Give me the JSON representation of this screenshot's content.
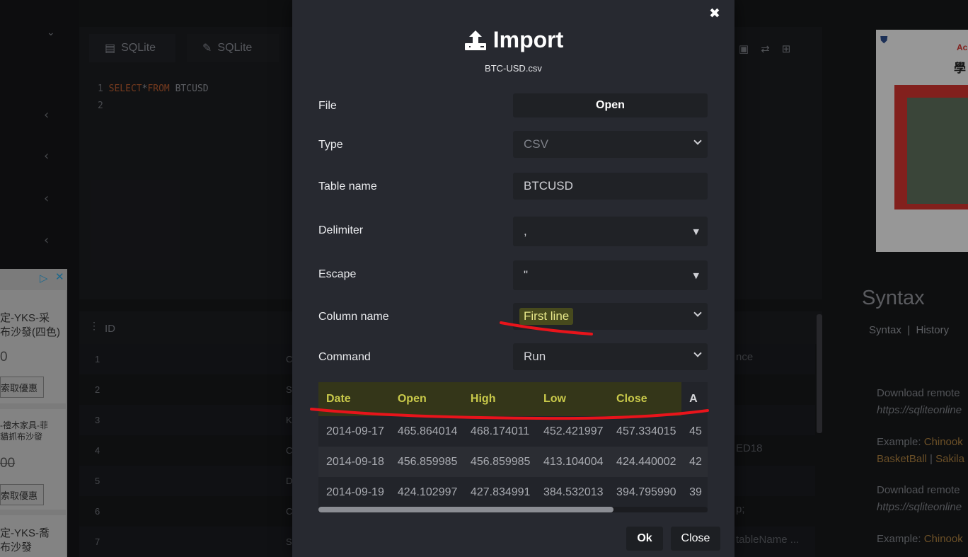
{
  "background": {
    "tabs": [
      {
        "icon": "database-icon",
        "label": "SQLite"
      },
      {
        "icon": "edit-icon",
        "label": "SQLite"
      }
    ],
    "code": {
      "line1_num": "1",
      "line1_kw1": "SELECT",
      "line1_star": "*",
      "line1_kw2": "FROM",
      "line1_table": "BTCUSD",
      "line2_num": "2"
    },
    "grid": {
      "id_header": "ID",
      "rows": [
        "1",
        "2",
        "3",
        "4",
        "5",
        "6",
        "7"
      ],
      "col2": [
        "C",
        "S",
        "K",
        "C",
        "D",
        "C",
        "S"
      ],
      "col3": [
        "nce",
        "",
        "",
        "ED18",
        "",
        "p;",
        "tableName ..."
      ]
    },
    "ads": {
      "card1_line1": "定-YKS-采",
      "card1_line2": "布沙發(四色)",
      "card1_price": "0",
      "card1_btn": "索取優惠",
      "card2_line1": "-禮木家具-菲",
      "card2_line2": "貓抓布沙發",
      "card2_price": "00",
      "card2_btn": "索取優惠",
      "card3_line1": "定-YKS-喬",
      "card3_line2": "布沙發"
    },
    "right_ad": {
      "text1": "Ac",
      "text2": "學"
    },
    "syntax": {
      "title": "Syntax",
      "link1": "Syntax",
      "sep": "|",
      "link2": "History",
      "p1": "Download remote",
      "p1_url": "https://sqliteonline",
      "p2_prefix": "Example: ",
      "p2_link1": "Chinook",
      "p2_link2": "BasketBall",
      "p2_sep": " | ",
      "p2_link3": "Sakila",
      "p3": "Download remote",
      "p3_url": "https://sqliteonline",
      "p4_prefix": "Example: ",
      "p4_link1": "Chinook"
    }
  },
  "modal": {
    "close_glyph": "✖",
    "title": "Import",
    "filename": "BTC-USD.csv",
    "fields": {
      "file_label": "File",
      "file_button": "Open",
      "type_label": "Type",
      "type_value": "CSV",
      "table_label": "Table name",
      "table_value": "BTCUSD",
      "delimiter_label": "Delimiter",
      "delimiter_value": ",",
      "escape_label": "Escape",
      "escape_value": "\"",
      "colname_label": "Column name",
      "colname_value": "First line",
      "command_label": "Command",
      "command_value": "Run"
    },
    "preview": {
      "headers": [
        "Date",
        "Open",
        "High",
        "Low",
        "Close",
        "A"
      ],
      "rows": [
        [
          "2014-09-17",
          "465.864014",
          "468.174011",
          "452.421997",
          "457.334015",
          "45"
        ],
        [
          "2014-09-18",
          "456.859985",
          "456.859985",
          "413.104004",
          "424.440002",
          "42"
        ],
        [
          "2014-09-19",
          "424.102997",
          "427.834991",
          "384.532013",
          "394.795990",
          "39"
        ]
      ]
    },
    "ok_label": "Ok",
    "close_label": "Close"
  },
  "colors": {
    "annotation_red": "#e8141b",
    "highlight_yellow": "#c9c94a",
    "modal_bg": "#272930"
  }
}
